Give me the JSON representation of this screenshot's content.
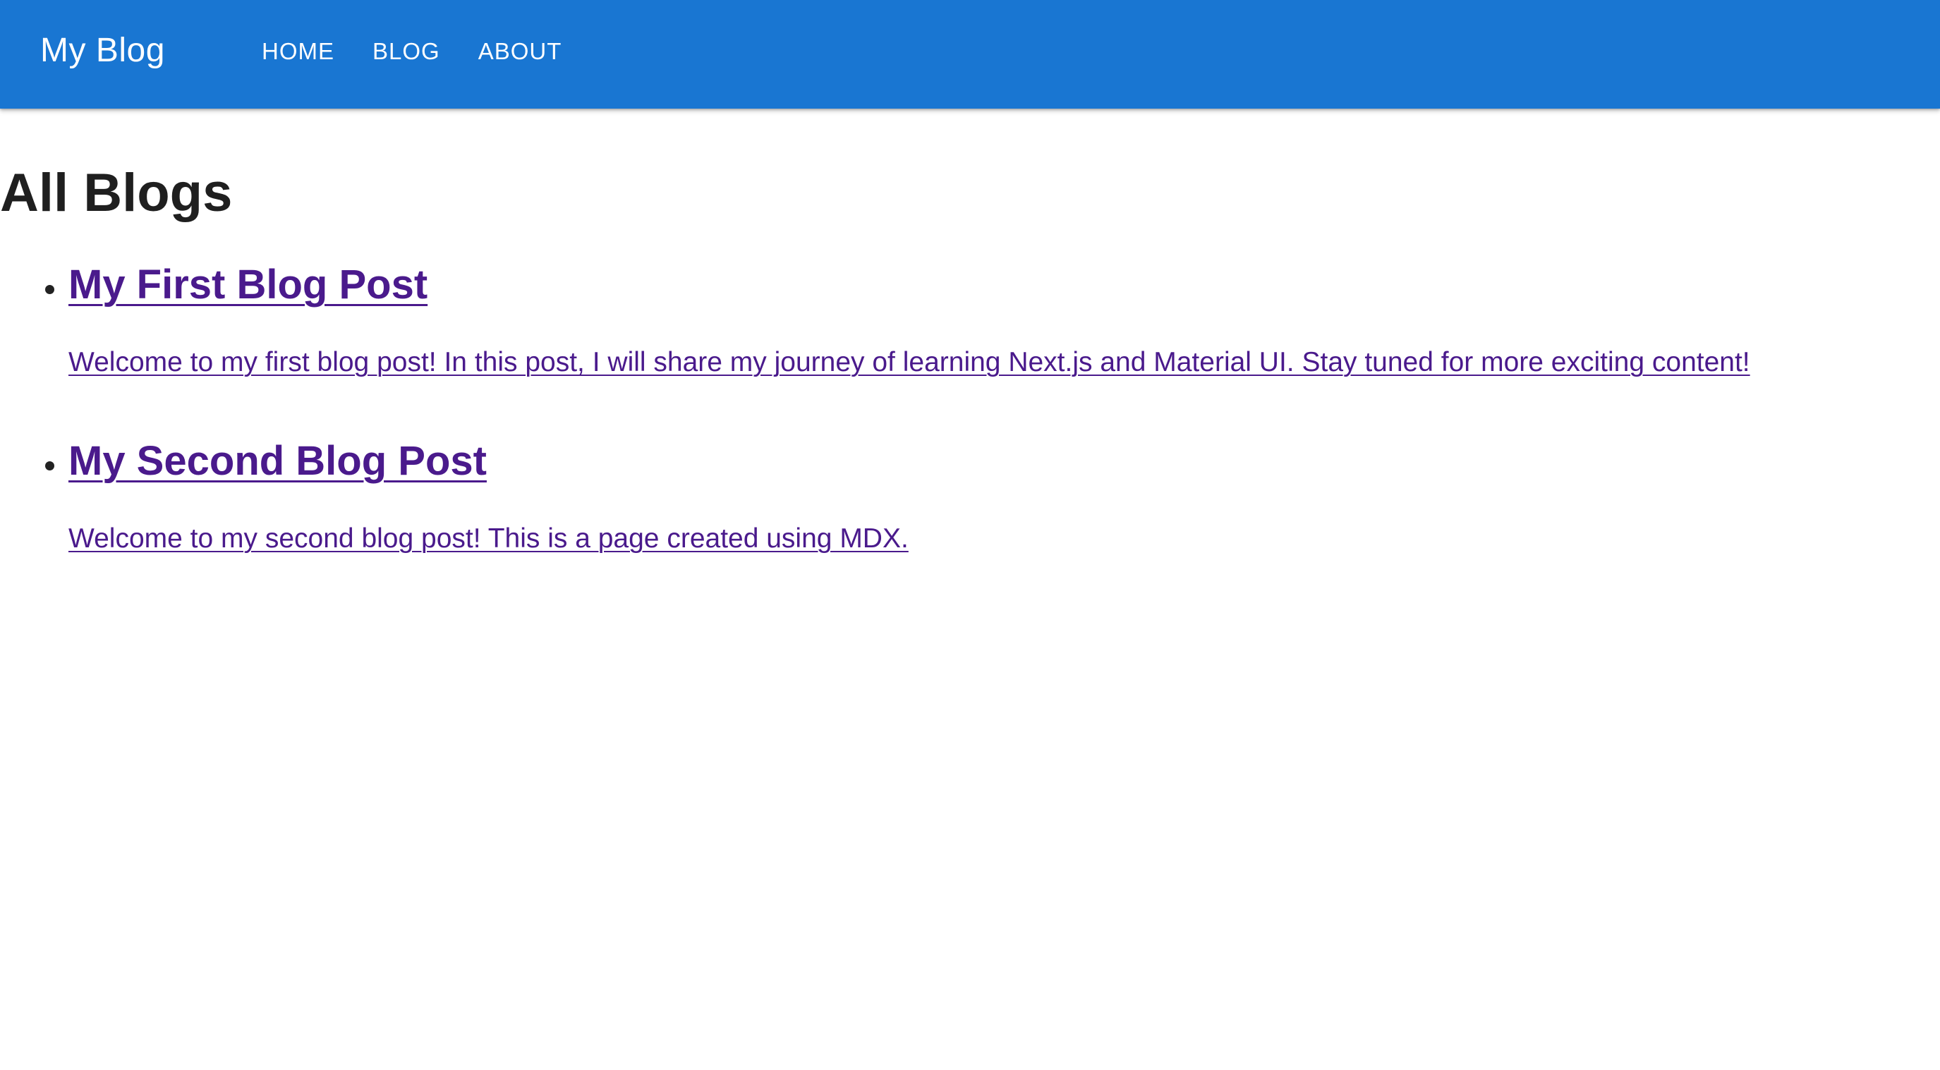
{
  "app": {
    "brand": "My Blog",
    "accent_color": "#1976d2",
    "link_color": "#4a1a8c"
  },
  "nav": {
    "items": [
      {
        "label": "HOME"
      },
      {
        "label": "BLOG"
      },
      {
        "label": "ABOUT"
      }
    ]
  },
  "main": {
    "title": "All Blogs",
    "posts": [
      {
        "title": "My First Blog Post",
        "excerpt": "Welcome to my first blog post! In this post, I will share my journey of learning Next.js and Material UI. Stay tuned for more exciting content!"
      },
      {
        "title": "My Second Blog Post",
        "excerpt": "Welcome to my second blog post! This is a page created using MDX."
      }
    ]
  }
}
